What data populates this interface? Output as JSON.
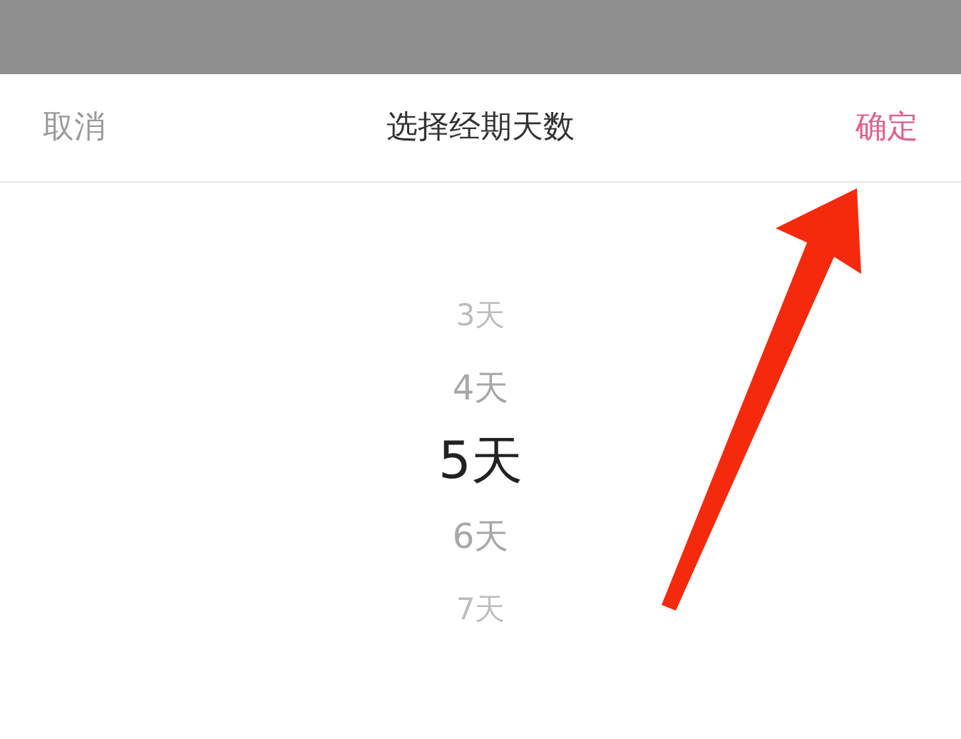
{
  "header": {
    "cancel": "取消",
    "title": "选择经期天数",
    "confirm": "确定"
  },
  "picker": [
    {
      "label": "3天",
      "selected": false
    },
    {
      "label": "4天",
      "selected": false
    },
    {
      "label": "5天",
      "selected": true
    },
    {
      "label": "6天",
      "selected": false
    },
    {
      "label": "7天",
      "selected": false
    }
  ]
}
